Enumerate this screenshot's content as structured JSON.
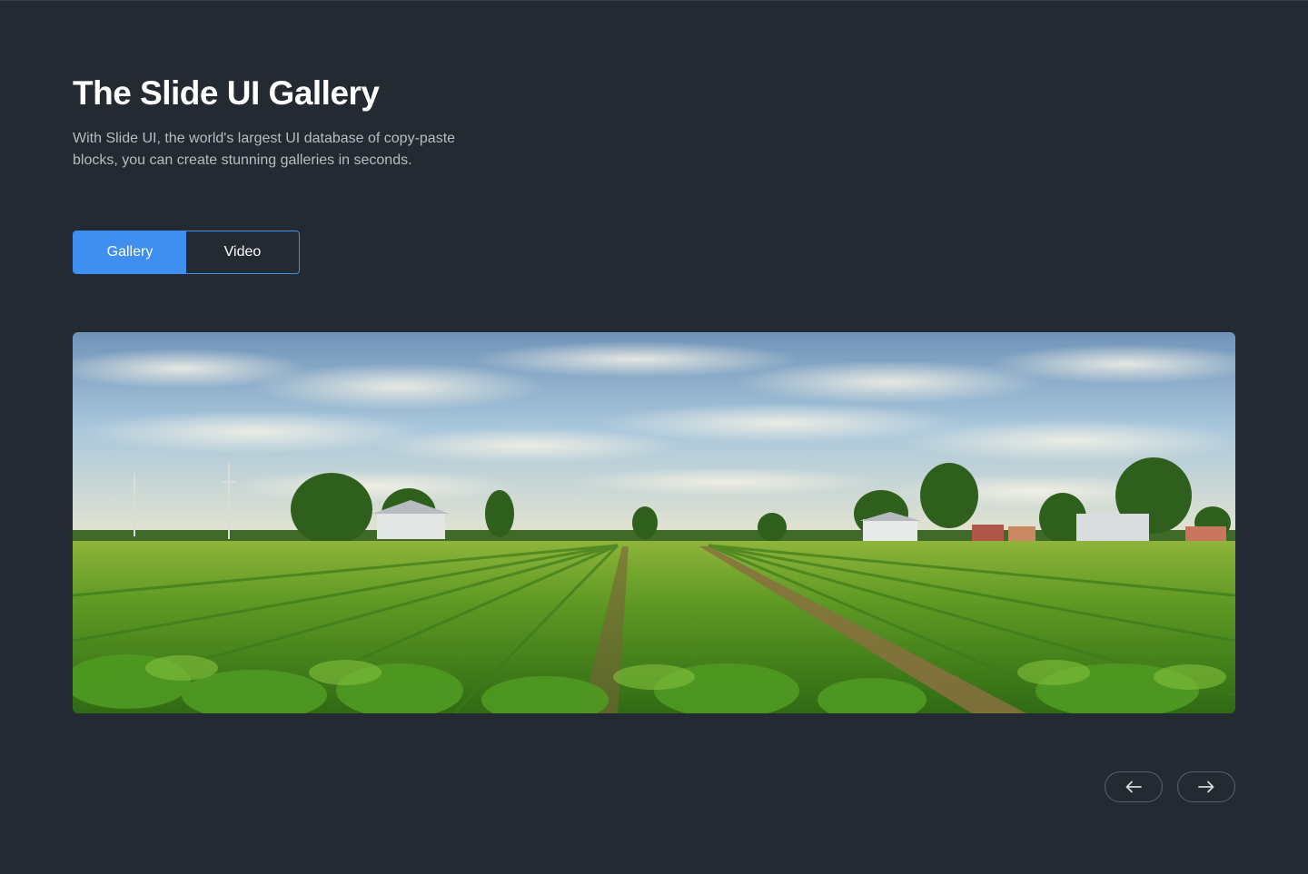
{
  "header": {
    "title": "The Slide UI Gallery",
    "subtitle": "With Slide UI, the world's largest UI database of copy-paste blocks, you can create stunning galleries in seconds."
  },
  "tabs": [
    {
      "label": "Gallery",
      "active": true
    },
    {
      "label": "Video",
      "active": false
    }
  ],
  "slide": {
    "image_description_icon": "farm-landscape-image"
  },
  "navigation": {
    "prev_icon": "arrow-left-icon",
    "next_icon": "arrow-right-icon"
  },
  "colors": {
    "background": "#232a31",
    "accent": "#3e8ff0",
    "text_primary": "#ffffff",
    "text_secondary": "#b7bdc4"
  }
}
